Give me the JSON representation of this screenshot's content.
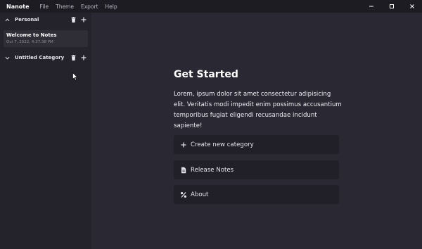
{
  "app": {
    "name": "Nanote"
  },
  "menu": {
    "items": [
      "File",
      "Theme",
      "Export",
      "Help"
    ]
  },
  "sidebar": {
    "categories": [
      {
        "label": "Personal",
        "expanded": true,
        "notes": [
          {
            "title": "Welcome to Notes",
            "date": "Oct 7, 2022, 4:37:38 PM"
          }
        ]
      },
      {
        "label": "Untitled Category",
        "expanded": true,
        "notes": []
      }
    ]
  },
  "main": {
    "heading": "Get Started",
    "intro": "Lorem, ipsum dolor sit amet consectetur adipisicing elit. Veritatis modi impedit enim possimus accusantium temporibus fugiat eligendi recusandae incidunt sapiente!",
    "actions": [
      {
        "label": "Create new category",
        "icon": "plus-icon"
      },
      {
        "label": "Release Notes",
        "icon": "document-icon"
      },
      {
        "label": "About",
        "icon": "percent-icon"
      }
    ]
  },
  "colors": {
    "titlebar": "#1d1c23",
    "sidebar": "#24232b",
    "main": "#2a2833",
    "card": "#211f28",
    "text": "#ffffff"
  }
}
